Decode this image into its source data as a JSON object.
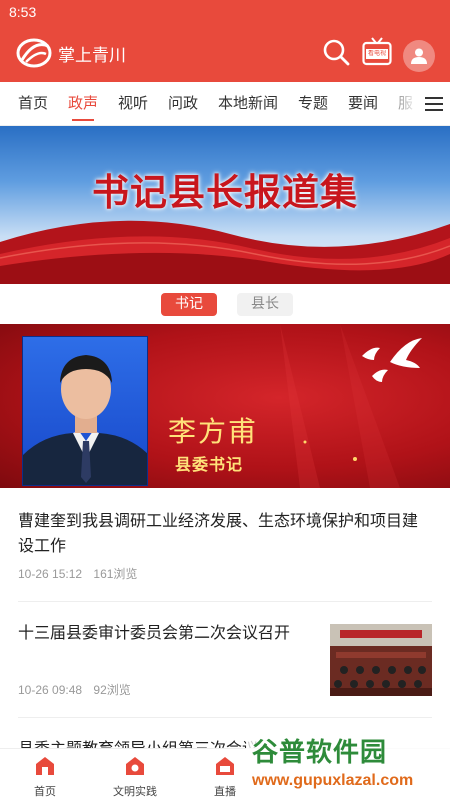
{
  "status_bar": {
    "time": "8:53"
  },
  "app_bar": {
    "title": "掌上青川",
    "tv_badge": "看电视",
    "icons": [
      "app-logo-icon",
      "search-icon",
      "tv-icon",
      "user-icon"
    ]
  },
  "tabs": {
    "active_index": 1,
    "items": [
      "首页",
      "政声",
      "视听",
      "问政",
      "本地新闻",
      "专题",
      "要闻",
      "服"
    ]
  },
  "banner": {
    "title": "书记县长报道集"
  },
  "segment": {
    "items": [
      "书记",
      "县长"
    ],
    "selected": "书记"
  },
  "leader": {
    "name": "李方甫",
    "position": "县委书记"
  },
  "news": [
    {
      "title": "曹建奎到我县调研工业经济发展、生态环境保护和项目建设工作",
      "date": "10-26 15:12",
      "views": "161浏览"
    },
    {
      "title": "十三届县委审计委员会第二次会议召开",
      "date": "10-26 09:48",
      "views": "92浏览"
    },
    {
      "title": "县委主题教育领导小组第三次会议",
      "date": "",
      "views": ""
    }
  ],
  "bottom_nav": {
    "items": [
      {
        "label": "首页",
        "icon": "home-icon"
      },
      {
        "label": "文明实践",
        "icon": "civilization-icon"
      },
      {
        "label": "直播",
        "icon": "live-icon"
      }
    ]
  },
  "watermark": {
    "text": "谷普软件园",
    "url": "www.gupuxlazal.com"
  },
  "colors": {
    "accent": "#e84a3c",
    "banner_red": "#c8161d",
    "leader_text": "#ffe27a"
  }
}
